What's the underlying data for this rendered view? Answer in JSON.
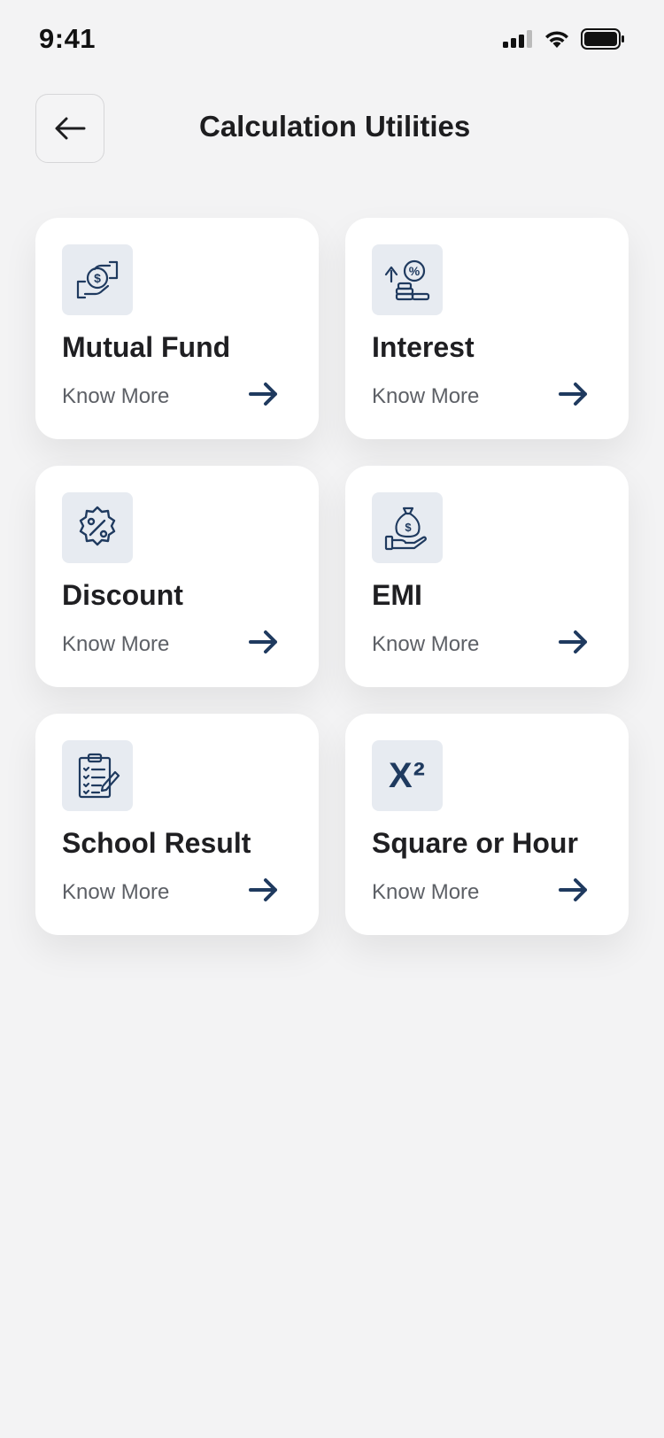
{
  "status": {
    "time": "9:41"
  },
  "header": {
    "title": "Calculation Utilities"
  },
  "cards": [
    {
      "title": "Mutual Fund",
      "link": "Know More",
      "icon": "money-hand-icon"
    },
    {
      "title": "Interest",
      "link": "Know More",
      "icon": "interest-growth-icon"
    },
    {
      "title": "Discount",
      "link": "Know More",
      "icon": "discount-badge-icon"
    },
    {
      "title": "EMI",
      "link": "Know More",
      "icon": "money-bag-hand-icon"
    },
    {
      "title": "School Result",
      "link": "Know More",
      "icon": "clipboard-checklist-icon"
    },
    {
      "title": "Square or Hour",
      "link": "Know More",
      "icon": "x-squared-icon",
      "glyph": "X²"
    }
  ],
  "colors": {
    "background": "#f3f3f4",
    "card": "#ffffff",
    "icon_bg": "#e7ebf1",
    "accent": "#1f3a5f",
    "text_muted": "#5d6066"
  }
}
